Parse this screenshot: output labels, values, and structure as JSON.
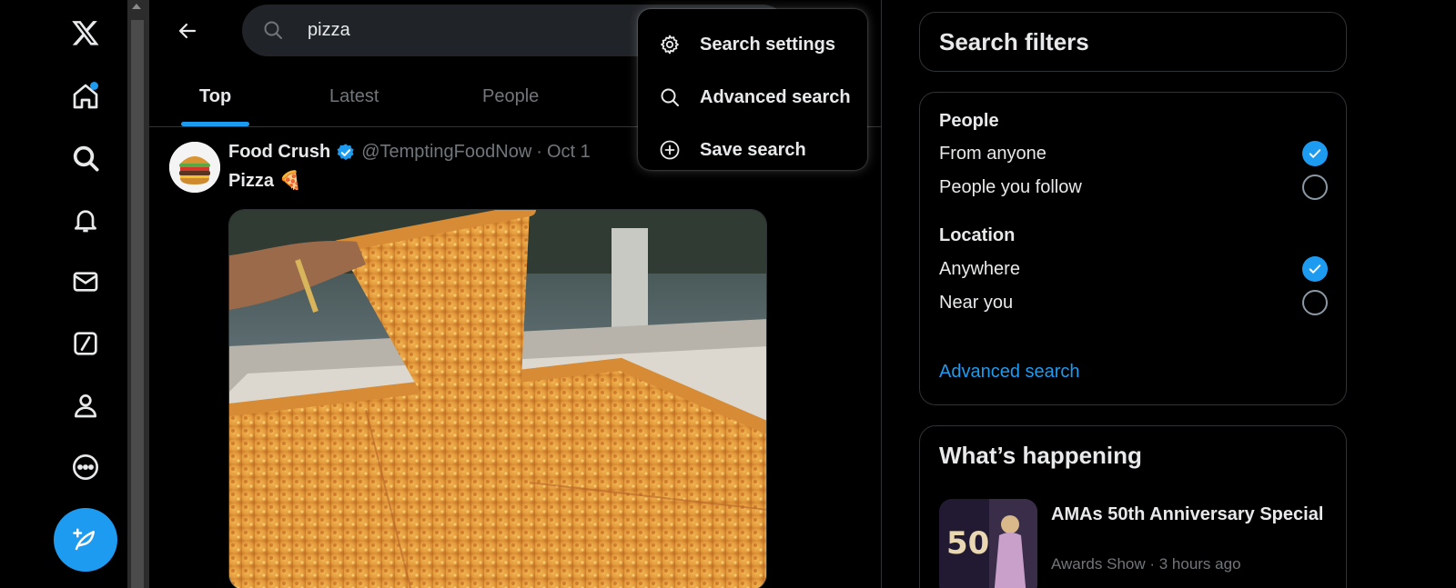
{
  "search": {
    "query": "pizza"
  },
  "tabs": [
    {
      "label": "Top"
    },
    {
      "label": "Latest"
    },
    {
      "label": "People"
    }
  ],
  "post": {
    "name": "Food Crush",
    "handle": "@TemptingFoodNow",
    "separator": "·",
    "date": "Oct 1",
    "text": "Pizza 🍕"
  },
  "menu": {
    "items": [
      {
        "label": "Search settings",
        "icon": "gear-icon"
      },
      {
        "label": "Advanced search",
        "icon": "search-icon"
      },
      {
        "label": "Save search",
        "icon": "plus-circle-icon"
      }
    ]
  },
  "filters": {
    "title": "Search filters",
    "people_heading": "People",
    "people_options": [
      {
        "label": "From anyone",
        "checked": true
      },
      {
        "label": "People you follow",
        "checked": false
      }
    ],
    "location_heading": "Location",
    "location_options": [
      {
        "label": "Anywhere",
        "checked": true
      },
      {
        "label": "Near you",
        "checked": false
      }
    ],
    "advanced_link": "Advanced search"
  },
  "happening": {
    "title": "What’s happening",
    "trend_title": "AMAs 50th Anniversary Special",
    "trend_category": "Awards Show",
    "trend_time": "3 hours ago",
    "trend_meta": "Awards Show · 3 hours ago"
  },
  "colors": {
    "accent": "#1d9bf0",
    "background": "#000000",
    "text": "#e7e9ea",
    "muted": "#71767b",
    "border": "#2f3336"
  }
}
